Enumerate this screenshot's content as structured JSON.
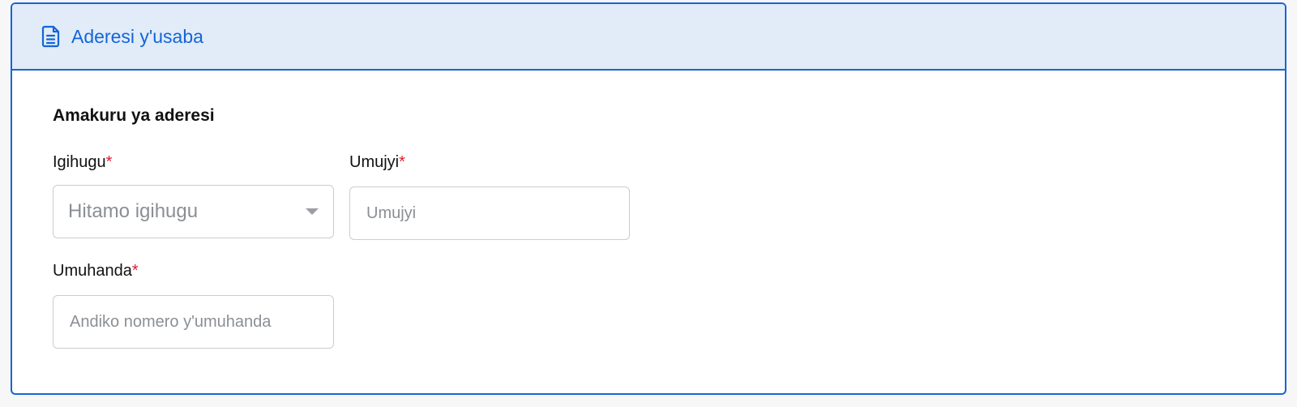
{
  "header": {
    "title": "Aderesi y'usaba",
    "icon": "document-icon",
    "accent_color": "#1565d8",
    "background_color": "#e1ecf8"
  },
  "section": {
    "title": "Amakuru ya aderesi"
  },
  "fields": {
    "country": {
      "label": "Igihugu",
      "required_marker": "*",
      "placeholder": "Hitamo igihugu"
    },
    "city": {
      "label": "Umujyi",
      "required_marker": "*",
      "placeholder": "Umujyi"
    },
    "street": {
      "label": "Umuhanda",
      "required_marker": "*",
      "placeholder": "Andiko nomero y'umuhanda"
    }
  },
  "colors": {
    "required": "#e3182d",
    "border": "#c9cdd2",
    "placeholder": "#8b8f94"
  }
}
